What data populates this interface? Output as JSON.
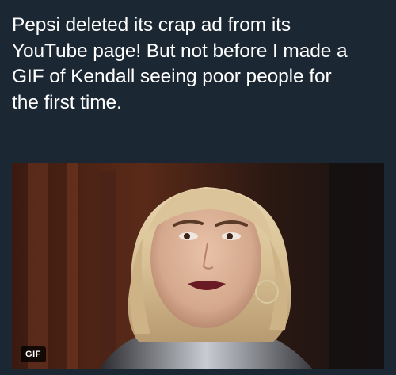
{
  "tweet": {
    "text": "Pepsi deleted its crap ad from its\nYouTube page! But not before I made a\nGIF of Kendall seeing poor people for\nthe first time."
  },
  "media": {
    "badge": "GIF"
  },
  "colors": {
    "background": "#1b2733",
    "text": "#ffffff"
  }
}
